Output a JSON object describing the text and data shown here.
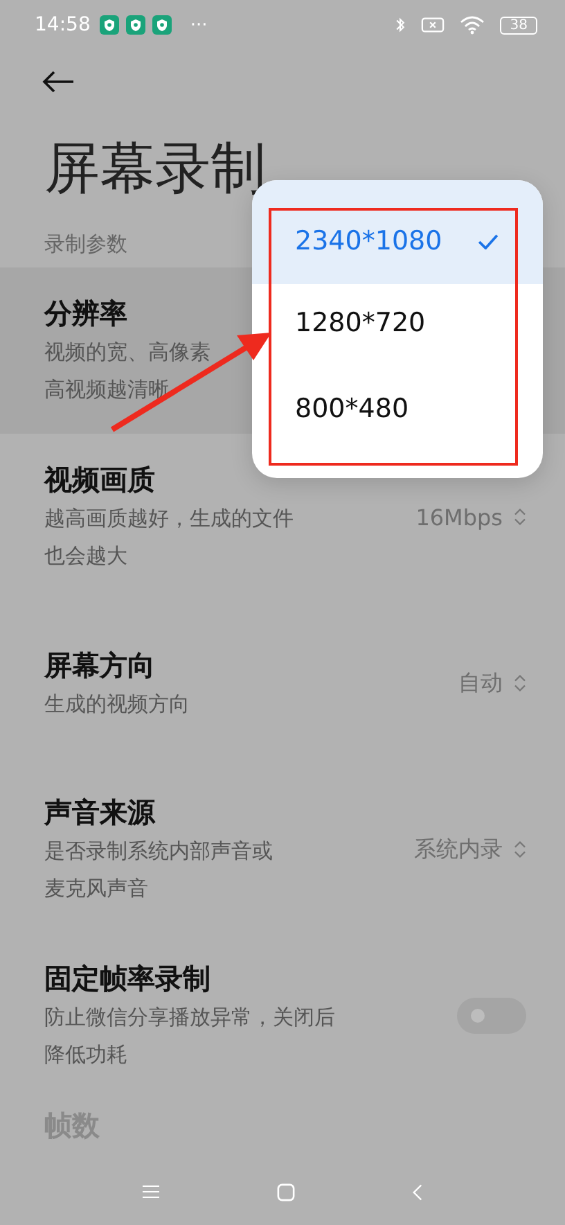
{
  "status_bar": {
    "time": "14:58",
    "more": "···",
    "battery": "38"
  },
  "page_title": "屏幕录制",
  "section_label": "录制参数",
  "settings": [
    {
      "kind": "select",
      "title": "分辨率",
      "description_lines": [
        "视频的宽、高像素",
        "高视频越清晰"
      ],
      "highlighted": true,
      "disabled": false
    },
    {
      "kind": "select",
      "title": "视频画质",
      "description_lines": [
        "越高画质越好，生成的文件",
        "也会越大"
      ],
      "value": "16Mbps",
      "disabled": false
    },
    {
      "kind": "select",
      "title": "屏幕方向",
      "description_lines": [
        "生成的视频方向"
      ],
      "value": "自动",
      "disabled": false
    },
    {
      "kind": "select",
      "title": "声音来源",
      "description_lines": [
        "是否录制系统内部声音或",
        "麦克风声音"
      ],
      "value": "系统内录",
      "disabled": false
    },
    {
      "kind": "toggle",
      "title": "固定帧率录制",
      "description_lines": [
        "防止微信分享播放异常，关闭后",
        "降低功耗"
      ],
      "on": false,
      "disabled": false
    },
    {
      "kind": "plain",
      "title": "帧数",
      "disabled": true
    }
  ],
  "dropdown": {
    "options": [
      {
        "label": "2340*1080",
        "selected": true
      },
      {
        "label": "1280*720",
        "selected": false
      },
      {
        "label": "800*480",
        "selected": false
      }
    ]
  },
  "annotation": {
    "kind": "arrow_and_box"
  }
}
